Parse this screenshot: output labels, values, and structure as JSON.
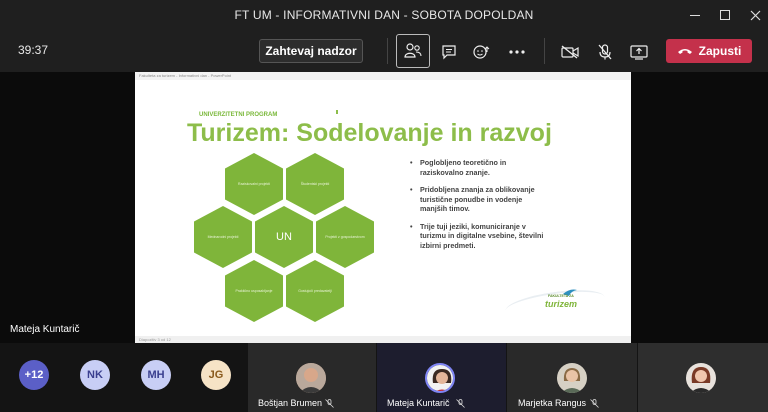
{
  "window": {
    "title": "FT UM - INFORMATIVNI DAN - SOBOTA DOPOLDAN"
  },
  "controls": {
    "timer": "39:37",
    "request_control_label": "Zahtevaj nadzor",
    "leave_label": "Zapusti",
    "leave_color": "#c4314b"
  },
  "slide": {
    "app_bar_text": "Fakulteta za turizem - Informativni dan - PowerPoint",
    "program_label": "UNIVERZITETNI PROGRAM",
    "title": "Turizem: Sodelovanje in razvoj",
    "accent_color": "#8dbd4a",
    "hexagons": [
      {
        "label": "Raziskovalni projekti"
      },
      {
        "label": "Študentski projekti"
      },
      {
        "label": "Mednarodni projekti"
      },
      {
        "label": "UN"
      },
      {
        "label": "Projekti z gospodarstvom"
      },
      {
        "label": "Praktično usposabljanje"
      },
      {
        "label": "Gostujoči predavatelji"
      }
    ],
    "bullets": [
      "Poglobljeno teoretično in raziskovalno znanje.",
      "Pridobljena znanja za oblikovanje turistične ponudbe in vodenje manjših timov.",
      "Trije tuji jeziki, komuniciranje v turizmu in digitalne vsebine, številni izbirni predmeti."
    ],
    "logo_small": "FAKULTETA ZA",
    "logo_main": "turizem",
    "status_left": "Diapozitiv 3 od 12",
    "presenter_name": "Mateja Kuntarič"
  },
  "participants": {
    "overflow_count": "+12",
    "avatars": [
      {
        "initials": "NK",
        "color": "#c8cef5"
      },
      {
        "initials": "MH",
        "color": "#c8cef5"
      },
      {
        "initials": "JG",
        "color": "#f6e3c6"
      }
    ],
    "tiles": [
      {
        "name": "Boštjan Brumen"
      },
      {
        "name": "Mateja Kuntarič"
      },
      {
        "name": "Marjetka Rangus"
      }
    ]
  }
}
